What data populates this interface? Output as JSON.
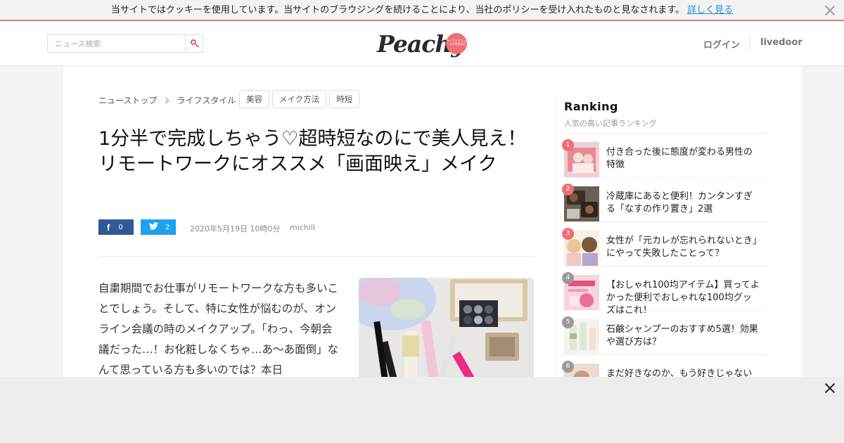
{
  "cookie": {
    "message": "当サイトではクッキーを使用しています。当サイトのブラウジングを続けることにより、当社のポリシーを受け入れたものと見なされます。",
    "link": "詳しく見る"
  },
  "header": {
    "search_placeholder": "ニュース検索",
    "logo_text": "Peachy",
    "logo_badge": "ライブドアニュースの女性向け",
    "login": "ログイン",
    "livedoor": "livedoor"
  },
  "breadcrumb": [
    "ニューストップ",
    "ライフスタイル"
  ],
  "tags": [
    "美容",
    "メイク方法",
    "時短"
  ],
  "article": {
    "title": "1分半で完成しちゃう♡超時短なのにで美人見え！リモートワークにオススメ「画面映え」メイク",
    "facebook_count": "0",
    "twitter_count": "2",
    "date": "2020年5月19日 10時0分",
    "author": "michill",
    "body": "自粛期間でお仕事がリモートワークな方も多いことでしょう。そして、特に女性が悩むのが、オンライン会議の時のメイクアップ。「わっ、今朝会議だった…！お化粧しなくちゃ…あ～あ面倒」なんて思っている方も多いのでは？本日"
  },
  "ranking": {
    "title": "Ranking",
    "subtitle": "人気の高い記事ランキング",
    "items": [
      {
        "num": "1",
        "title": "付き合った後に態度が変わる男性の特徴",
        "color": "#ee6f74"
      },
      {
        "num": "2",
        "title": "冷蔵庫にあると便利！カンタンすぎる「なすの作り置き」2選",
        "color": "#ee6f74"
      },
      {
        "num": "3",
        "title": "女性が「元カレが忘れられないとき」にやって失敗したことって？",
        "color": "#ee6f74"
      },
      {
        "num": "4",
        "title": "【おしゃれ100均アイテム】買ってよかった便利でおしゃれな100均グッズはこれ！",
        "color": "#9a9a9a"
      },
      {
        "num": "5",
        "title": "石鹸シャンプーのおすすめ5選！効果や選び方は？",
        "color": "#9a9a9a"
      },
      {
        "num": "6",
        "title": "まだ好きなのか、もう好きじゃない",
        "color": "#9a9a9a"
      }
    ]
  }
}
